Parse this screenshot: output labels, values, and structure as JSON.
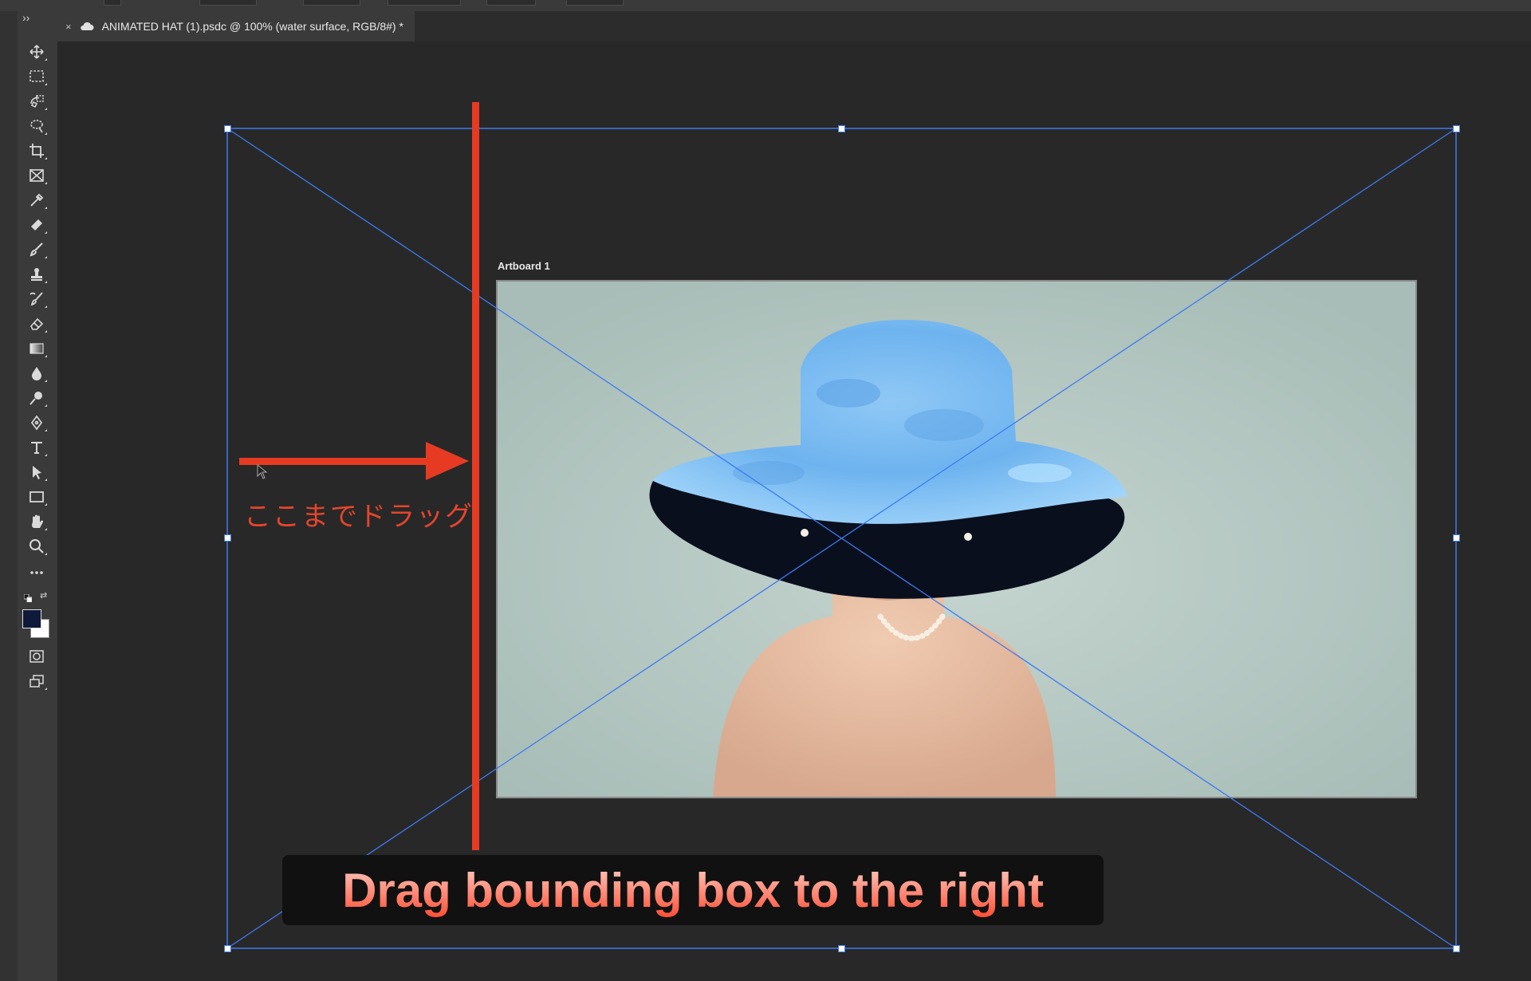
{
  "document_tab": {
    "close_glyph": "×",
    "title": "ANIMATED HAT (1).psdc @ 100% (water surface, RGB/8#) *"
  },
  "toolbar": {
    "collapse_glyph": "››",
    "tools": [
      "move-tool",
      "marquee-tool",
      "object-selection-tool",
      "lasso-tool",
      "crop-tool",
      "frame-tool",
      "eyedropper-tool",
      "healing-brush-tool",
      "brush-tool",
      "clone-stamp-tool",
      "history-brush-tool",
      "eraser-tool",
      "gradient-tool",
      "blur-tool",
      "dodge-tool",
      "pen-tool",
      "type-tool",
      "path-selection-tool",
      "rectangle-tool",
      "hand-tool",
      "zoom-tool",
      "more-tools"
    ],
    "foreground_color": "#0f1a3a",
    "background_color": "#ffffff"
  },
  "artboard": {
    "label": "Artboard 1",
    "background": "#b4c7c2"
  },
  "annotation": {
    "japanese_label": "ここまでドラッグ",
    "caption": "Drag bounding box to the right",
    "accent_color": "#e63b22"
  },
  "bounding_box_color": "#3d7bf0"
}
